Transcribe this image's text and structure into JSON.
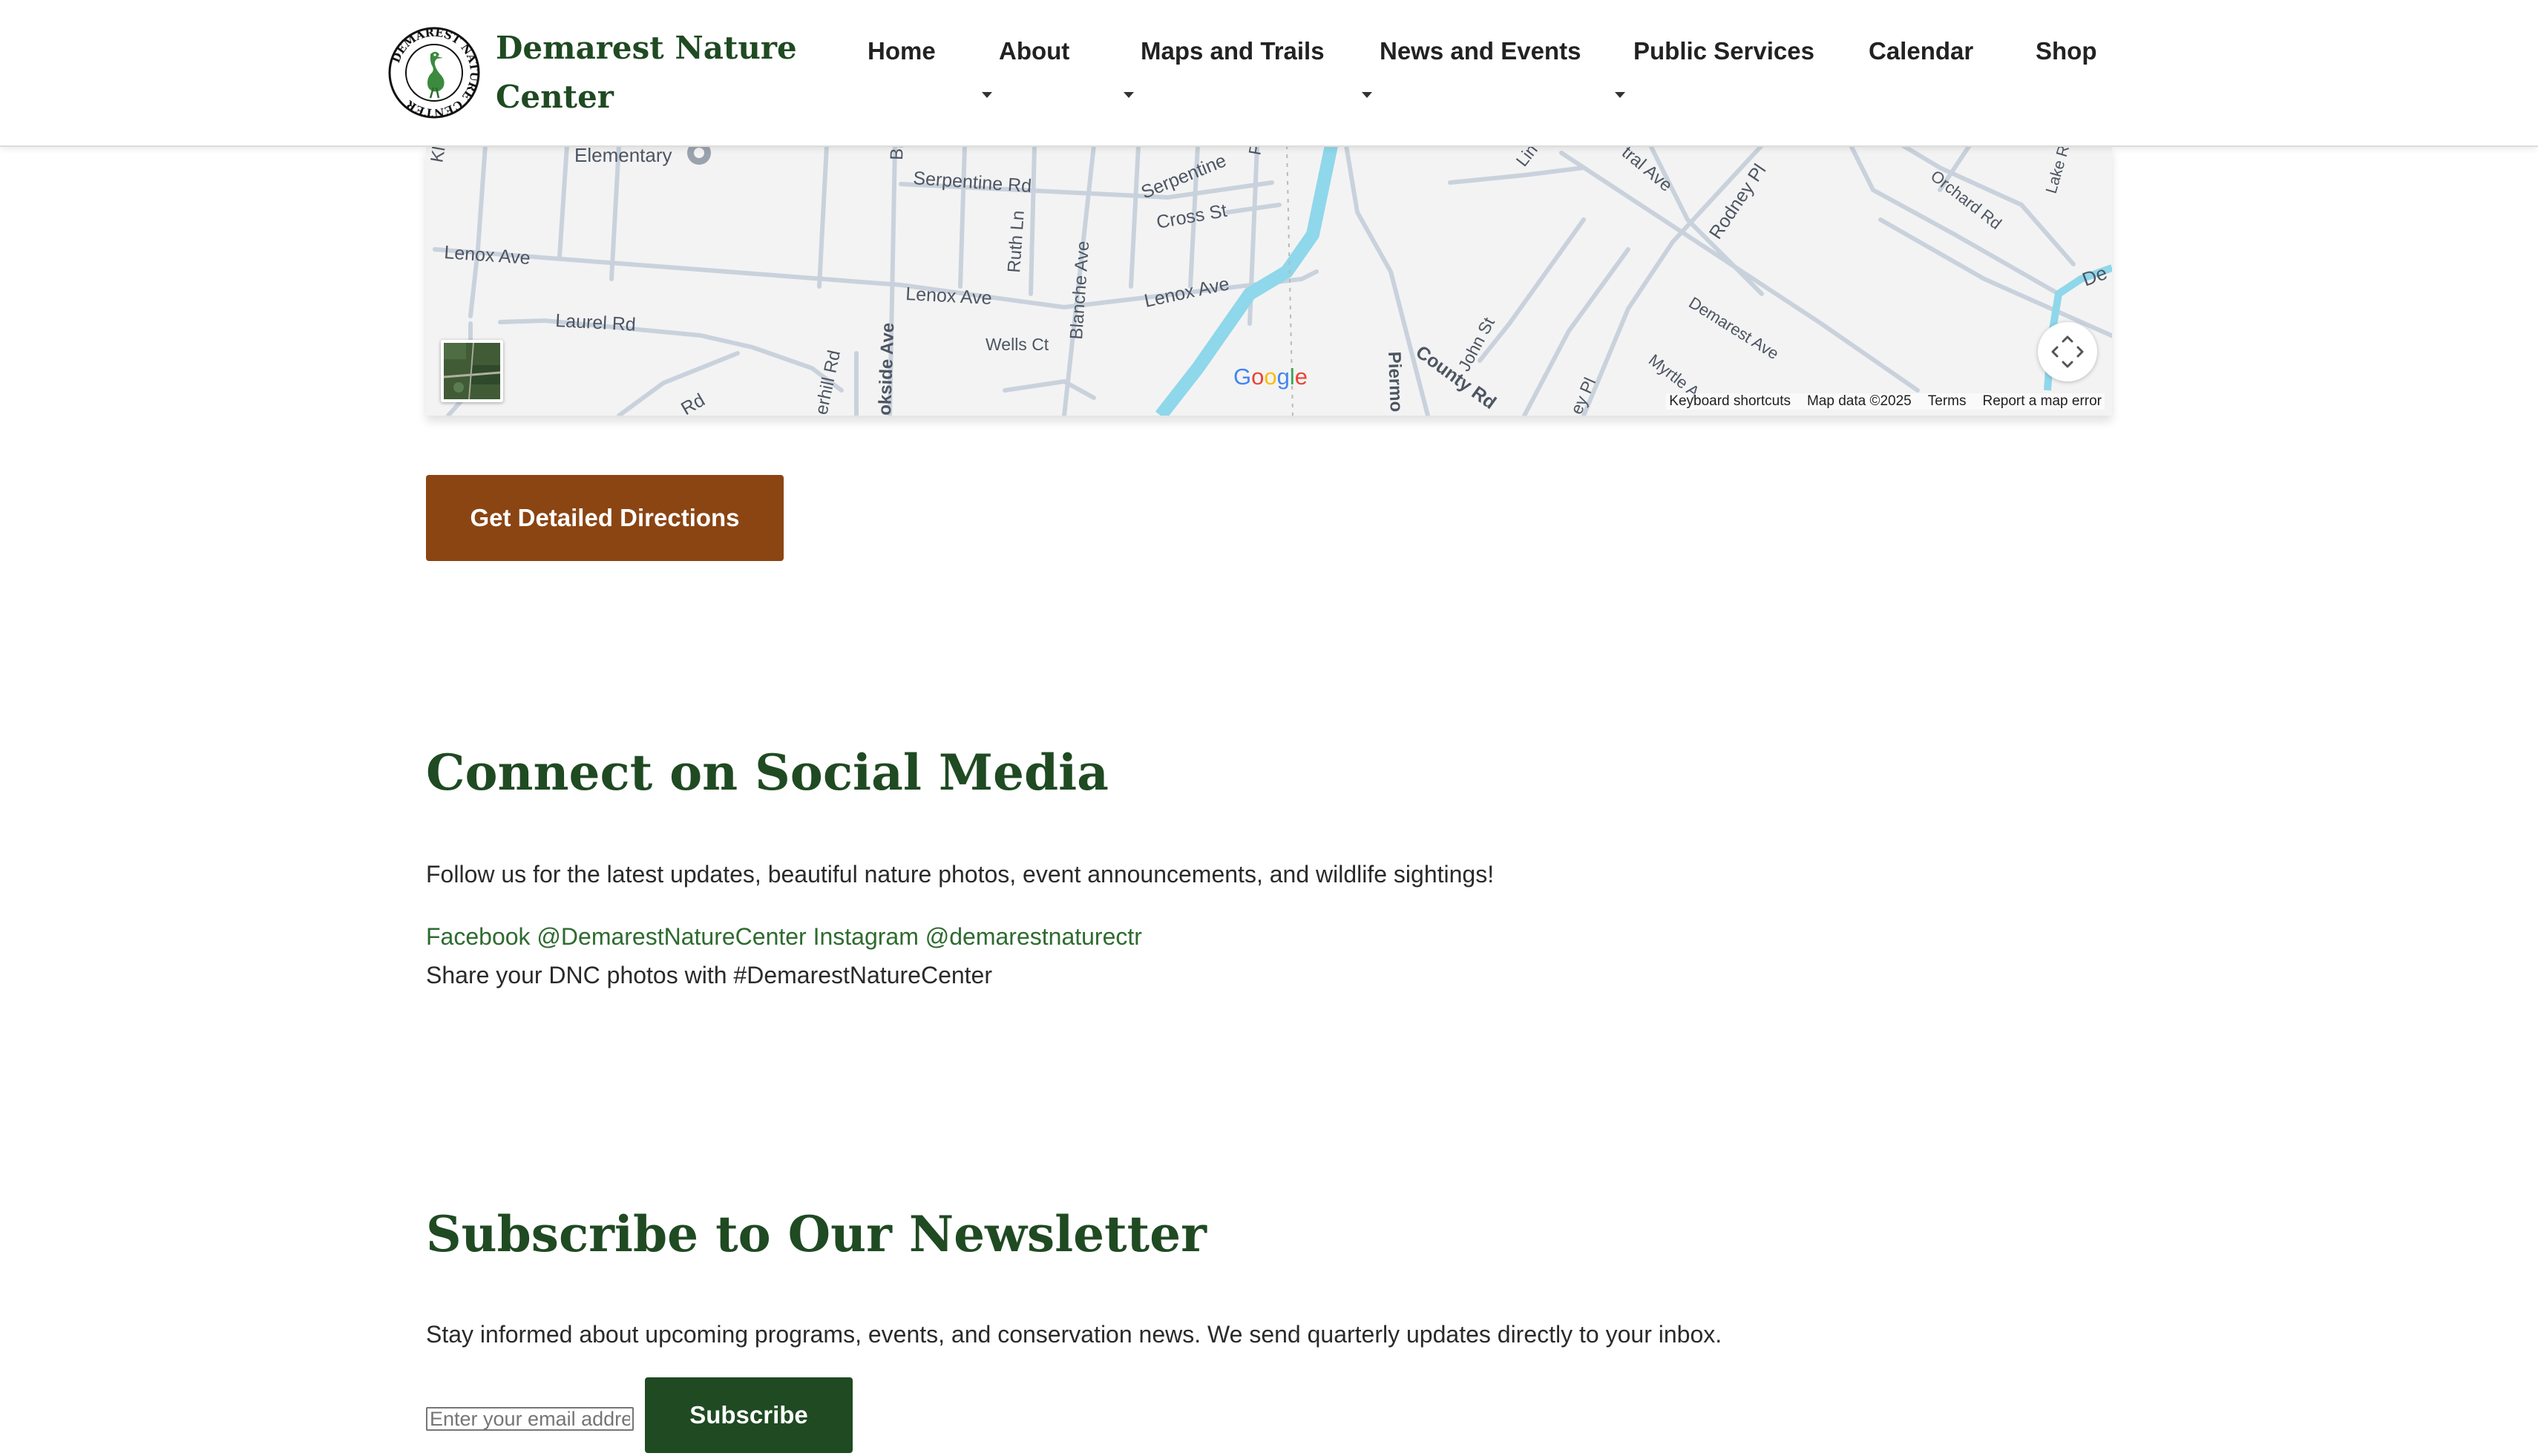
{
  "header": {
    "brand_name": "Demarest Nature Center",
    "logo_text": "DEMAREST NATURE CENTER",
    "nav": [
      {
        "label": "Home",
        "has_dropdown": false
      },
      {
        "label": "About",
        "has_dropdown": true
      },
      {
        "label": "Maps and Trails",
        "has_dropdown": true
      },
      {
        "label": "News and Events",
        "has_dropdown": true
      },
      {
        "label": "Public Services",
        "has_dropdown": true
      },
      {
        "label": "Calendar",
        "has_dropdown": false
      },
      {
        "label": "Shop",
        "has_dropdown": false
      }
    ]
  },
  "map": {
    "street_labels": [
      "Elementary",
      "Serpentine Rd",
      "Serpentine",
      "Cross St",
      "Ruth Ln",
      "Blanche Ave",
      "Lenox Ave",
      "Lenox Ave",
      "Lenox Ave",
      "Laurel Rd",
      "Wells Ct",
      "Rd",
      "erhill Rd",
      "okside Ave",
      "Piermo",
      "County Rd",
      "John St",
      "ey Pl",
      "Myrtle A",
      "Demarest Ave",
      "Rodney Pl",
      "tral Ave",
      "Lin",
      "Orchard Rd",
      "Lake R",
      "De",
      "Kl",
      "Bl",
      "P"
    ],
    "google_logo": "Google",
    "footer": {
      "shortcuts": "Keyboard shortcuts",
      "map_data": "Map data ©2025",
      "terms": "Terms",
      "report": "Report a map error"
    }
  },
  "directions": {
    "button_label": "Get Detailed Directions"
  },
  "social": {
    "heading": "Connect on Social Media",
    "description": "Follow us for the latest updates, beautiful nature photos, event announcements, and wildlife sightings!",
    "facebook_link": "Facebook @DemarestNatureCenter",
    "instagram_link": "Instagram @demarestnaturectr",
    "share_text": "Share your DNC photos with #DemarestNatureCenter"
  },
  "newsletter": {
    "heading": "Subscribe to Our Newsletter",
    "description": "Stay informed about upcoming programs, events, and conservation news. We send quarterly updates directly to your inbox.",
    "email_placeholder": "Enter your email address",
    "email_value": "",
    "subscribe_label": "Subscribe"
  },
  "colors": {
    "brand_green": "#1f4a22",
    "link_green": "#2e6b2f",
    "directions_brown": "#8b4513",
    "river_blue": "#8fd7ea"
  }
}
